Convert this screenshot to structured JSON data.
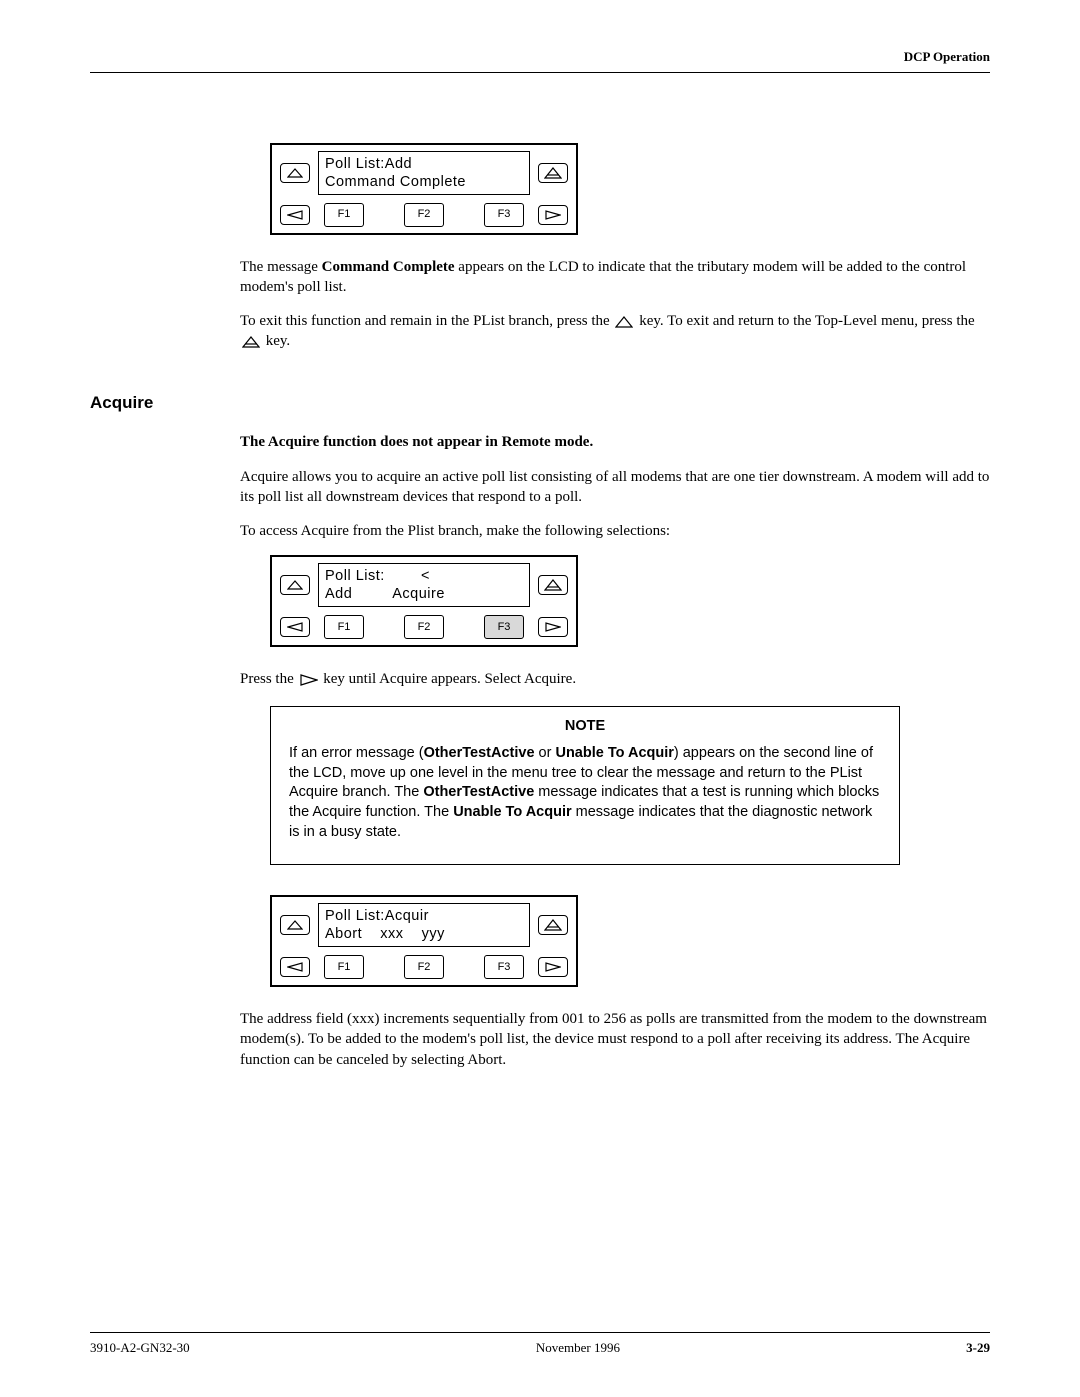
{
  "header": {
    "right": "DCP Operation"
  },
  "panel1": {
    "line1": "Poll List:Add",
    "line2": "Command Complete",
    "f1": "F1",
    "f2": "F2",
    "f3": "F3"
  },
  "para1a": "The message ",
  "para1bold": "Command Complete",
  "para1b": " appears on the LCD to indicate that the tributary modem will be added to the control modem's poll list.",
  "para2a": "To exit this function and remain in the PList branch, press the ",
  "para2b": " key. To exit and return to the Top-Level menu, press the ",
  "para2c": " key.",
  "section": "Acquire",
  "subhead": "The Acquire function does not appear in Remote mode.",
  "para3": "Acquire allows you to acquire an active poll list consisting of all modems that are one tier downstream. A modem will add to its poll list all downstream devices that respond to a poll.",
  "para4": "To access Acquire from the Plist branch, make the following selections:",
  "panel2": {
    "line1": "Poll List:        <",
    "line2": "Add         Acquire",
    "f1": "F1",
    "f2": "F2",
    "f3": "F3"
  },
  "para5a": "Press the ",
  "para5b": " key until Acquire appears. Select Acquire.",
  "note": {
    "title": "NOTE",
    "t1": "If an error message (",
    "b1": "OtherTestActive",
    "t2": " or ",
    "b2": "Unable To Acquir",
    "t3": ") appears on the second line of the LCD, move up one level in the menu tree to clear the message and return to the PList Acquire branch. The ",
    "b3": "OtherTestActive",
    "t4": " message indicates that a test is running which blocks the Acquire function. The ",
    "b4": "Unable To Acquir",
    "t5": " message indicates that the diagnostic network is in a busy state."
  },
  "panel3": {
    "line1": "Poll List:Acquir",
    "line2": "Abort    xxx    yyy",
    "f1": "F1",
    "f2": "F2",
    "f3": "F3"
  },
  "para6": "The address field (xxx) increments sequentially from 001 to 256 as polls are transmitted from the modem to the downstream modem(s). To be added to the modem's poll list, the device must respond to a poll after receiving its address. The Acquire function can be canceled by selecting Abort.",
  "footer": {
    "left": "3910-A2-GN32-30",
    "center": "November 1996",
    "right": "3-29"
  }
}
